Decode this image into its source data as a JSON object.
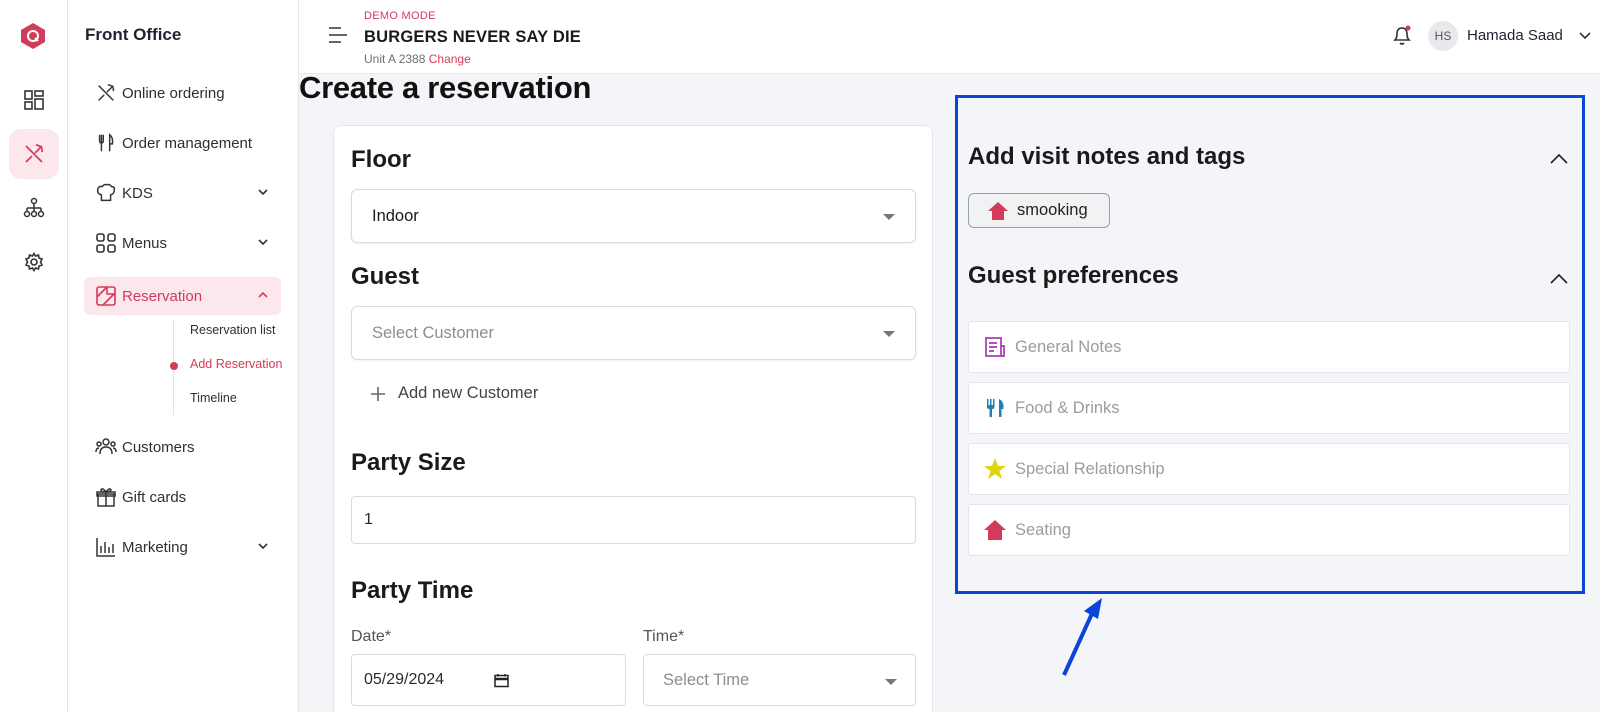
{
  "sidebar": {
    "title": "Front Office",
    "items": [
      {
        "label": "Online ordering",
        "icon": "utensils-cross-icon"
      },
      {
        "label": "Order management",
        "icon": "fork-knife-icon"
      },
      {
        "label": "KDS",
        "icon": "chef-hat-icon",
        "expandable": true
      },
      {
        "label": "Menus",
        "icon": "grid-icon",
        "expandable": true
      },
      {
        "label": "Reservation",
        "icon": "reservation-icon",
        "expandable": true,
        "active": true
      },
      {
        "label": "Customers",
        "icon": "users-icon"
      },
      {
        "label": "Gift cards",
        "icon": "gift-icon"
      },
      {
        "label": "Marketing",
        "icon": "bar-chart-icon",
        "expandable": true
      }
    ],
    "reservation_sub": [
      {
        "label": "Reservation list"
      },
      {
        "label": "Add Reservation",
        "active": true
      },
      {
        "label": "Timeline"
      }
    ]
  },
  "header": {
    "demo_mode": "DEMO MODE",
    "restaurant": "BURGERS NEVER SAY DIE",
    "unit": "Unit A 2388",
    "change": "Change",
    "avatar_initials": "HS",
    "user_name": "Hamada Saad"
  },
  "page": {
    "title": "Create a reservation"
  },
  "form": {
    "floor_title": "Floor",
    "floor_value": "Indoor",
    "guest_title": "Guest",
    "guest_placeholder": "Select Customer",
    "add_customer": "Add new Customer",
    "party_size_title": "Party Size",
    "party_size_value": "1",
    "party_time_title": "Party Time",
    "date_label": "Date*",
    "date_value": "05/29/2024",
    "time_label": "Time*",
    "time_placeholder": "Select Time"
  },
  "right_panel": {
    "notes_title": "Add visit notes and tags",
    "tag": "smooking",
    "prefs_title": "Guest preferences",
    "preferences": [
      {
        "label": "General Notes",
        "icon": "notes-icon",
        "color": "#a23bb0"
      },
      {
        "label": "Food & Drinks",
        "icon": "fork-knife-icon",
        "color": "#1f7fb6"
      },
      {
        "label": "Special Relationship",
        "icon": "star-icon",
        "color": "#e0d40a"
      },
      {
        "label": "Seating",
        "icon": "house-icon",
        "color": "#d23b5a"
      }
    ]
  },
  "colors": {
    "accent": "#d23b5a",
    "annotation": "#0a44d8"
  }
}
